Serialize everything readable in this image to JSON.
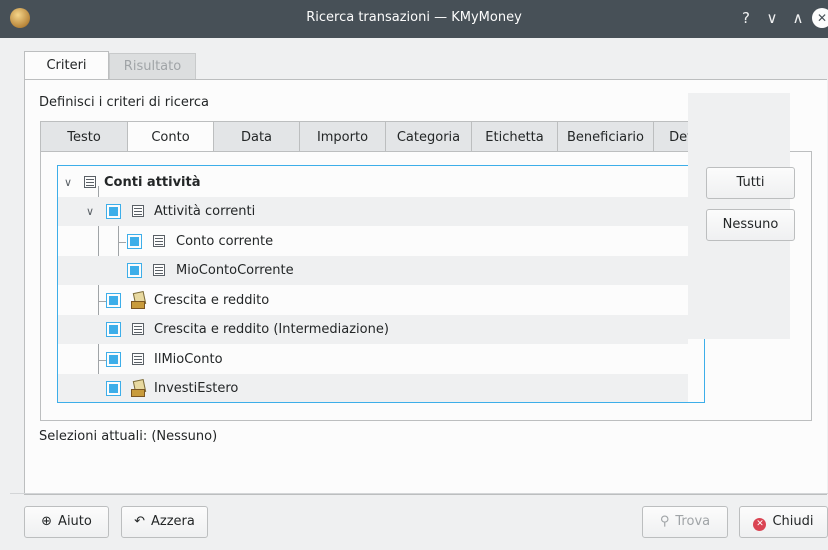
{
  "window": {
    "title": "Ricerca transazioni — KMyMoney",
    "controls": {
      "help": "?",
      "minimize": "∨",
      "maximize": "∧",
      "close": "✕"
    }
  },
  "outer_tabs": [
    {
      "label": "Criteri",
      "active": true
    },
    {
      "label": "Risultato",
      "active": false
    }
  ],
  "criteria": {
    "heading": "Definisci i criteri di ricerca",
    "tabs": [
      {
        "label": "Testo"
      },
      {
        "label": "Conto",
        "active": true
      },
      {
        "label": "Data"
      },
      {
        "label": "Importo"
      },
      {
        "label": "Categoria"
      },
      {
        "label": "Etichetta"
      },
      {
        "label": "Beneficiario"
      },
      {
        "label": "Dettagli"
      }
    ]
  },
  "tree": {
    "root": {
      "label": "Conti attività",
      "icon": "account-icon",
      "expanded": true
    },
    "items": [
      {
        "label": "Attività correnti",
        "icon": "account-icon",
        "level": 1,
        "expanded": true,
        "checked": true
      },
      {
        "label": "Conto corrente",
        "icon": "account-icon",
        "level": 2,
        "checked": true
      },
      {
        "label": "MioContoCorrente",
        "icon": "account-icon",
        "level": 2,
        "checked": true
      },
      {
        "label": "Crescita e reddito",
        "icon": "investment-icon",
        "level": 1,
        "checked": true
      },
      {
        "label": "Crescita e reddito (Intermediazione)",
        "icon": "account-icon",
        "level": 1,
        "checked": true
      },
      {
        "label": "IlMioConto",
        "icon": "account-icon",
        "level": 1,
        "checked": true
      },
      {
        "label": "InvestiEstero",
        "icon": "investment-icon",
        "level": 1,
        "checked": true
      }
    ]
  },
  "side_buttons": {
    "all": "Tutti",
    "none": "Nessuno"
  },
  "status": "Selezioni attuali: (Nessuno)",
  "footer": {
    "help": "Aiuto",
    "reset": "Azzera",
    "find": "Trova",
    "close": "Chiudi"
  },
  "colors": {
    "accent": "#3daee9",
    "titlebar": "#475057",
    "close_red": "#da4453"
  }
}
